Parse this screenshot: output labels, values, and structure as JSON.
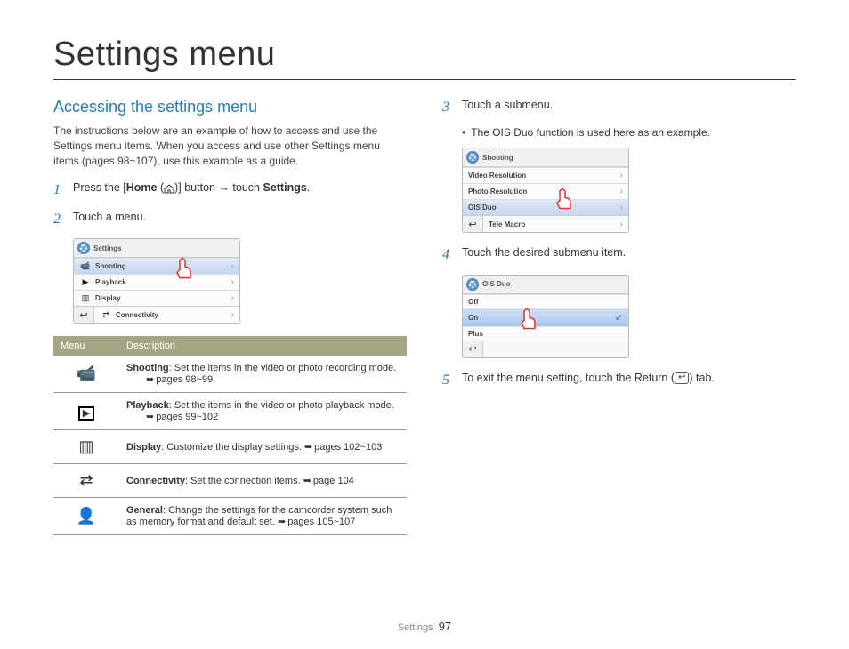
{
  "page_title": "Settings menu",
  "section_heading": "Accessing the settings menu",
  "intro": "The instructions below are an example of how to access and use the Settings menu items. When you access and use other Settings menu items (pages 98~107), use this example as a guide.",
  "steps": {
    "s1_pre": "Press the [",
    "s1_home": "Home",
    "s1_mid": " (",
    "s1_post": ")] button → touch ",
    "s1_settings": "Settings",
    "s1_end": ".",
    "s2": "Touch a menu.",
    "s3": "Touch a submenu.",
    "s3_sub": "The OIS Duo function is used here as an example.",
    "s4": "Touch the desired submenu item.",
    "s5_pre": "To exit the menu setting, touch the Return (",
    "s5_post": ") tab."
  },
  "panel1": {
    "title": "Settings",
    "items": [
      "Shooting",
      "Playback",
      "Display",
      "Connectivity"
    ]
  },
  "panel2": {
    "title": "Shooting",
    "items": [
      "Video Resolution",
      "Photo Resolution",
      "OIS Duo",
      "Tele Macro"
    ]
  },
  "panel3": {
    "title": "OIS Duo",
    "items": [
      "Off",
      "On",
      "Plus"
    ]
  },
  "table": {
    "col1": "Menu",
    "col2": "Description",
    "rows": [
      {
        "bold": "Shooting",
        "text": ": Set the items in the video or photo recording mode.",
        "ref": "pages 98~99"
      },
      {
        "bold": "Playback",
        "text": ": Set the items in the video or photo playback mode.",
        "ref": "pages 99~102"
      },
      {
        "bold": "Display",
        "text": ": Customize the display settings. ",
        "ref": "pages 102~103"
      },
      {
        "bold": "Connectivity",
        "text": ": Set the connection items. ",
        "ref": "page 104"
      },
      {
        "bold": "General",
        "text": ": Change the settings for the camcorder system such as memory format and default set. ",
        "ref": "pages 105~107"
      }
    ]
  },
  "footer": {
    "label": "Settings",
    "page": "97"
  }
}
